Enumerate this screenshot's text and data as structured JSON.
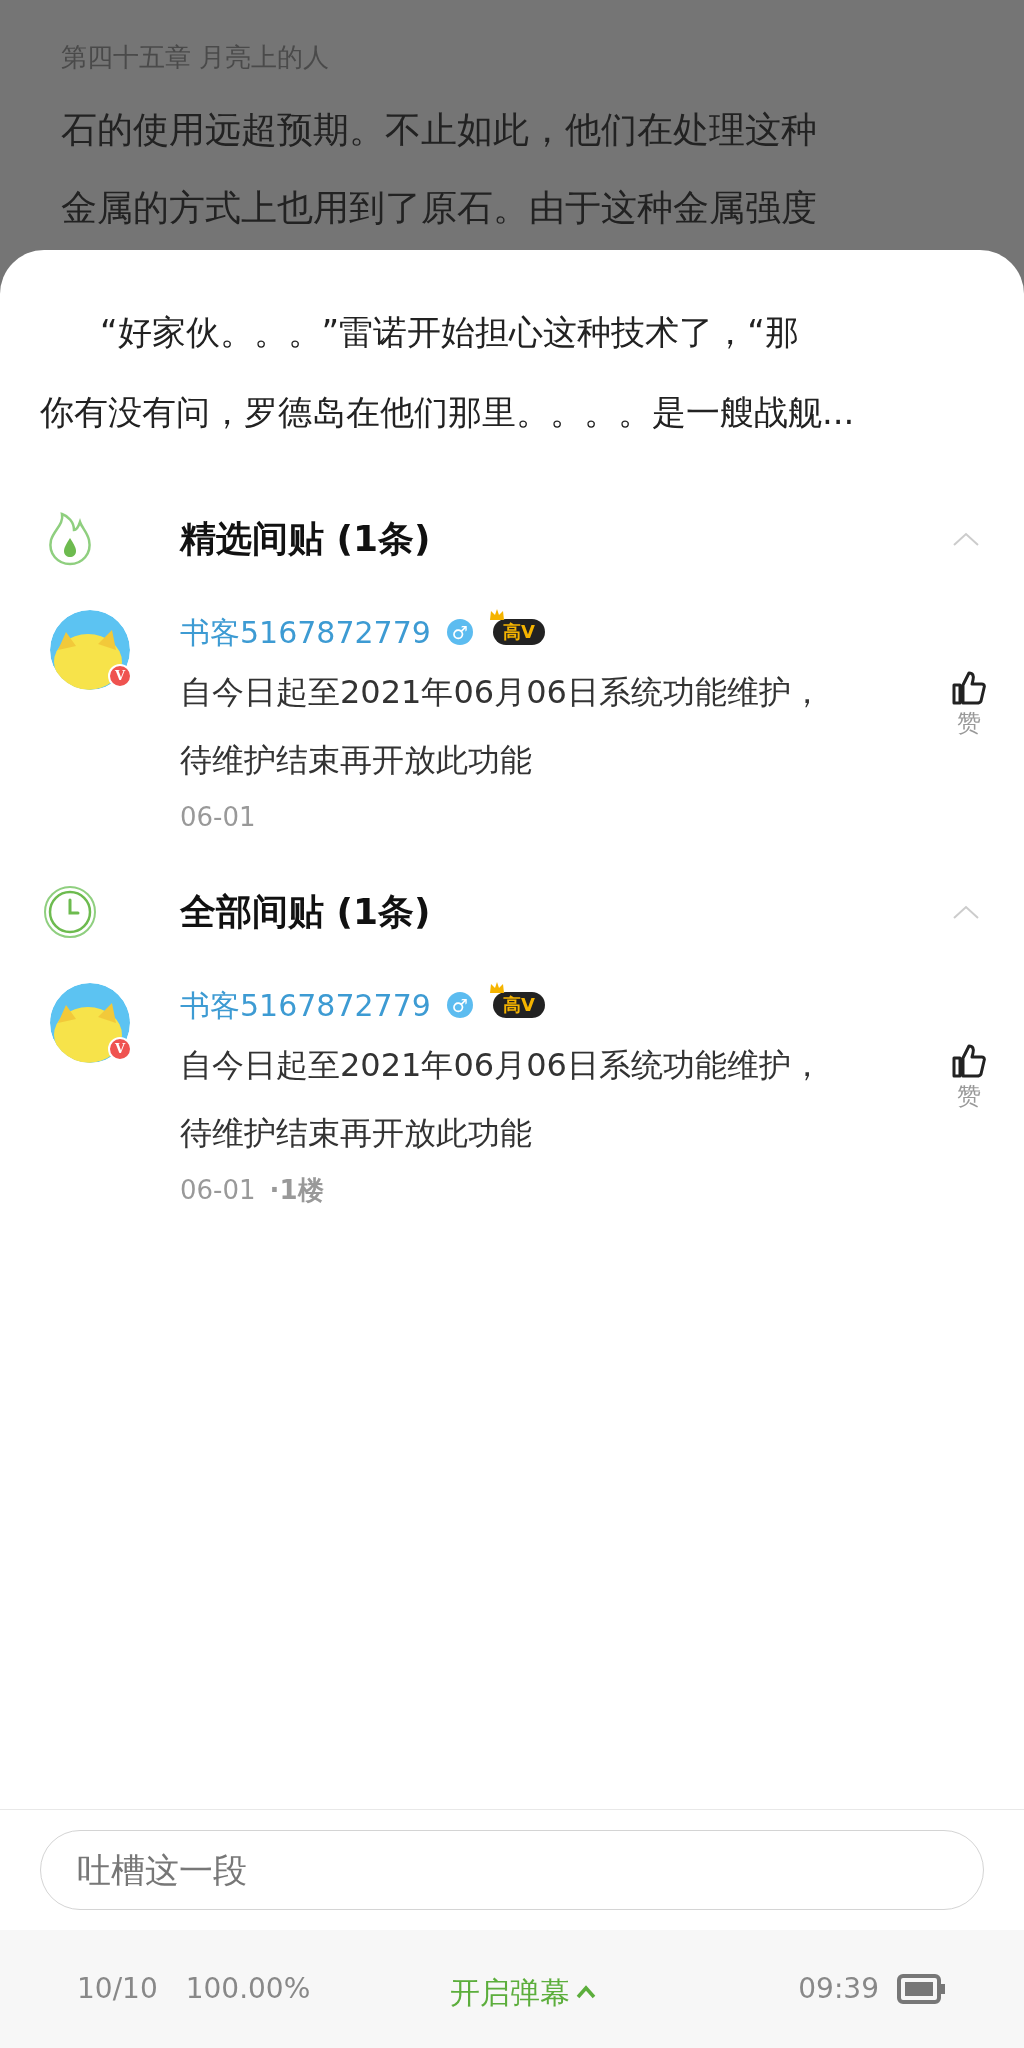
{
  "chapter": {
    "title": "第四十五章  月亮上的人",
    "body_lines": [
      "石的使用远超预期。不止如此，他们在处理这种",
      "金属的方式上也用到了原石。由于这种金属强度"
    ]
  },
  "quote_lines": [
    "“好家伙。。。”雷诺开始担心这种技术了，“那",
    "你有没有问，罗德岛在他们那里。。。。是一艘战舰..."
  ],
  "sections": [
    {
      "kind": "featured",
      "title": "精选间贴 (1条)",
      "expanded": true,
      "comments": [
        {
          "user": "书客5167872779",
          "avatar_badge": "V",
          "gender": "♂",
          "level_badge": "高V",
          "lines": [
            "自今日起至2021年06月06日系统功能维护，",
            "待维护结束再开放此功能"
          ],
          "date": "06-01",
          "like_label": "赞"
        }
      ]
    },
    {
      "kind": "all",
      "title": "全部间贴 (1条)",
      "expanded": true,
      "comments": [
        {
          "user": "书客5167872779",
          "avatar_badge": "V",
          "gender": "♂",
          "level_badge": "高V",
          "lines": [
            "自今日起至2021年06月06日系统功能维护，",
            "待维护结束再开放此功能"
          ],
          "date": "06-01",
          "floor": "·1楼",
          "like_label": "赞"
        }
      ]
    }
  ],
  "input": {
    "placeholder": "吐槽这一段"
  },
  "status_bar": {
    "page": "10/10",
    "progress": "100.00%",
    "danmaku": "开启弹幕",
    "time": "09:39"
  }
}
